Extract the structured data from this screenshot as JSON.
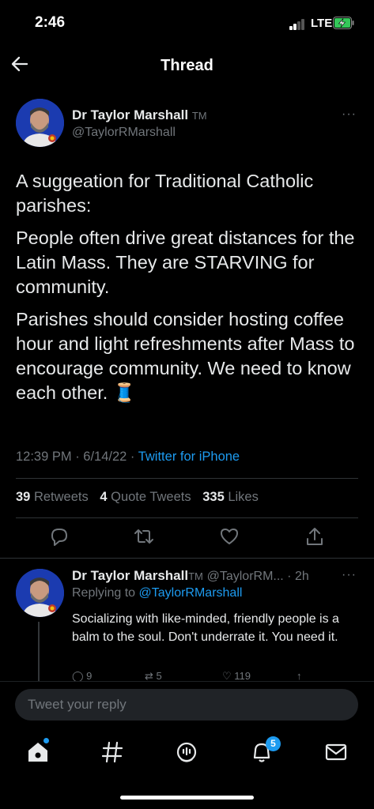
{
  "status_bar": {
    "time": "2:46",
    "network": "LTE"
  },
  "header": {
    "title": "Thread"
  },
  "main_tweet": {
    "author_name": "Dr Taylor Marshall",
    "trademark": "TM",
    "handle": "@TaylorRMarshall",
    "more": "···",
    "paragraphs": [
      "A suggeation for Traditional Catholic parishes:",
      "People often drive great distances for the Latin Mass. They are STARVING for community.",
      "Parishes should consider hosting coffee hour and light refreshments after Mass to encourage community. We need to know each other. 🧵"
    ],
    "timestamp": "12:39 PM · 6/14/22 · ",
    "source": "Twitter for iPhone",
    "stats": {
      "retweets_count": "39",
      "retweets_label": "Retweets",
      "quotes_count": "4",
      "quotes_label": "Quote Tweets",
      "likes_count": "335",
      "likes_label": "Likes"
    }
  },
  "reply": {
    "author_name": "Dr Taylor Marshall",
    "trademark": "TM",
    "handle_time": "@TaylorRM... · 2h",
    "more": "···",
    "replying_prefix": "Replying to ",
    "replying_handle": "@TaylorRMarshall",
    "text": "Socializing with like-minded, friendly people is a balm to the soul. Don't underrate it. You need it.",
    "reply_count": "9",
    "retweet_count": "5",
    "like_count": "119"
  },
  "composer": {
    "placeholder": "Tweet your reply"
  },
  "tab_bar": {
    "notifications_badge": "5"
  },
  "colors": {
    "accent": "#1d9bf0",
    "background": "#000000",
    "muted": "#71767b"
  }
}
